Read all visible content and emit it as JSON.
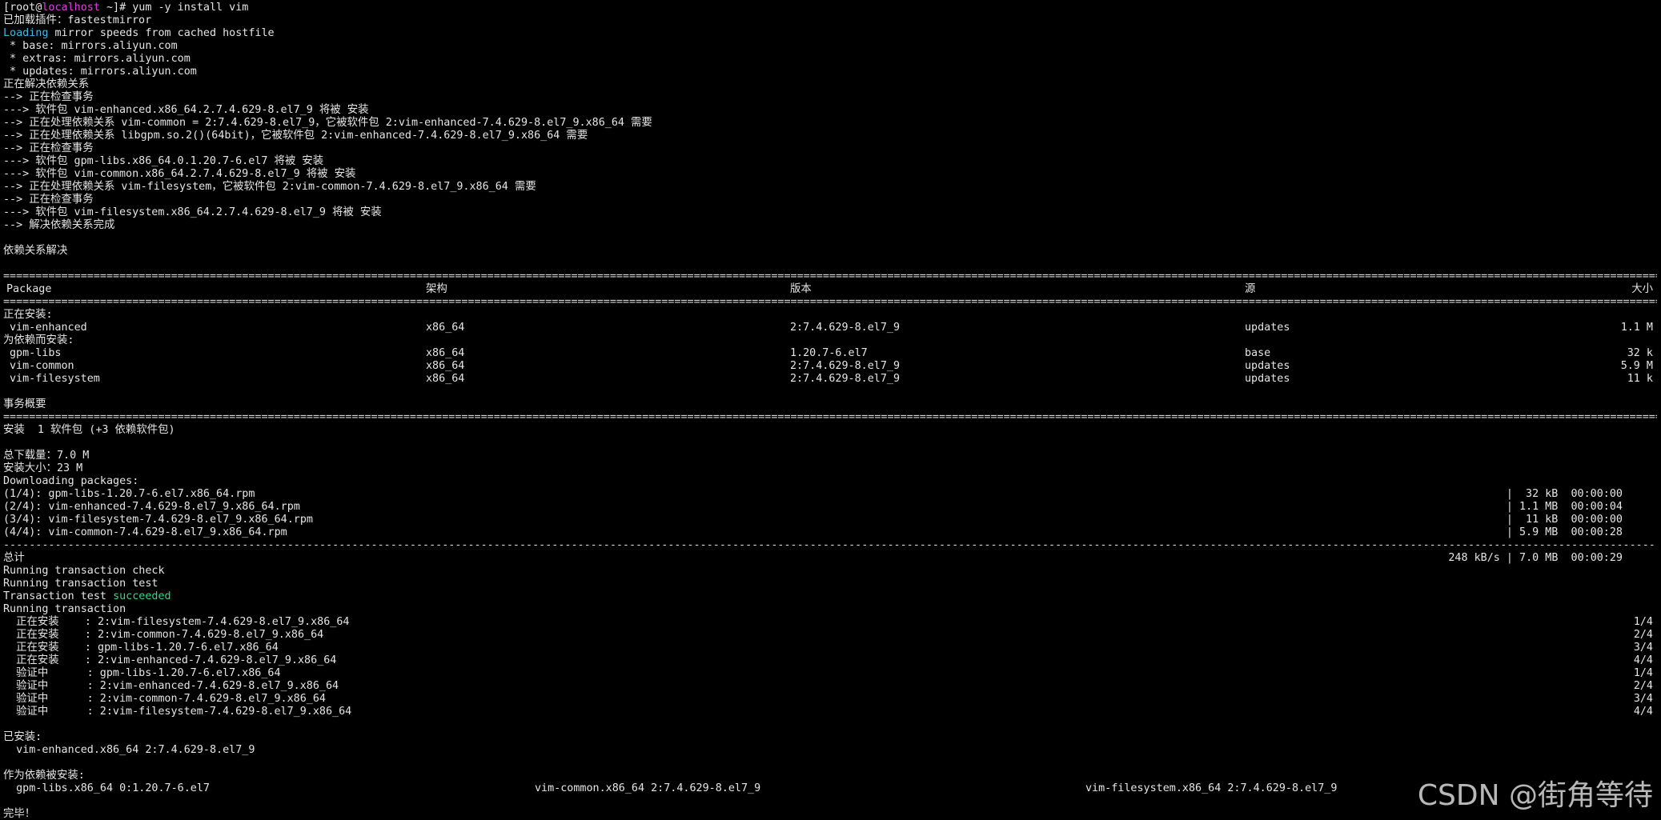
{
  "prompt": {
    "open": "[",
    "user": "root",
    "at": "@",
    "host": "localhost",
    "rest": " ~]# ",
    "command": "yum -y install vim"
  },
  "pre_lines": [
    "已加载插件：fastestmirror"
  ],
  "loading": {
    "word": "Loading",
    "rest": " mirror speeds from cached hostfile"
  },
  "mirror_lines": [
    " * base: mirrors.aliyun.com",
    " * extras: mirrors.aliyun.com",
    " * updates: mirrors.aliyun.com",
    "正在解决依赖关系",
    "--> 正在检查事务",
    "---> 软件包 vim-enhanced.x86_64.2.7.4.629-8.el7_9 将被 安装",
    "--> 正在处理依赖关系 vim-common = 2:7.4.629-8.el7_9，它被软件包 2:vim-enhanced-7.4.629-8.el7_9.x86_64 需要",
    "--> 正在处理依赖关系 libgpm.so.2()(64bit)，它被软件包 2:vim-enhanced-7.4.629-8.el7_9.x86_64 需要",
    "--> 正在检查事务",
    "---> 软件包 gpm-libs.x86_64.0.1.20.7-6.el7 将被 安装",
    "---> 软件包 vim-common.x86_64.2.7.4.629-8.el7_9 将被 安装",
    "--> 正在处理依赖关系 vim-filesystem，它被软件包 2:vim-common-7.4.629-8.el7_9.x86_64 需要",
    "--> 正在检查事务",
    "---> 软件包 vim-filesystem.x86_64.2.7.4.629-8.el7_9 将被 安装",
    "--> 解决依赖关系完成",
    "",
    "依赖关系解决",
    ""
  ],
  "table": {
    "headers": {
      "package": "Package",
      "arch": "架构",
      "version": "版本",
      "repo": "源",
      "size": "大小"
    },
    "installing_label": "正在安装:",
    "installing": [
      {
        "name": "vim-enhanced",
        "arch": "x86_64",
        "version": "2:7.4.629-8.el7_9",
        "repo": "updates",
        "size": "1.1 M"
      }
    ],
    "deps_label": "为依赖而安装:",
    "deps": [
      {
        "name": "gpm-libs",
        "arch": "x86_64",
        "version": "1.20.7-6.el7",
        "repo": "base",
        "size": "32 k"
      },
      {
        "name": "vim-common",
        "arch": "x86_64",
        "version": "2:7.4.629-8.el7_9",
        "repo": "updates",
        "size": "5.9 M"
      },
      {
        "name": "vim-filesystem",
        "arch": "x86_64",
        "version": "2:7.4.629-8.el7_9",
        "repo": "updates",
        "size": "11 k"
      }
    ]
  },
  "summary_title": "事务概要",
  "summary_line": "安装  1 软件包 (+3 依赖软件包)",
  "total_download": "总下载量：7.0 M",
  "install_size": "安装大小：23 M",
  "downloading_label": "Downloading packages:",
  "downloads": [
    {
      "file": "(1/4): gpm-libs-1.20.7-6.el7.x86_64.rpm",
      "stats": "|  32 kB  00:00:00"
    },
    {
      "file": "(2/4): vim-enhanced-7.4.629-8.el7_9.x86_64.rpm",
      "stats": "| 1.1 MB  00:00:04"
    },
    {
      "file": "(3/4): vim-filesystem-7.4.629-8.el7_9.x86_64.rpm",
      "stats": "|  11 kB  00:00:00"
    },
    {
      "file": "(4/4): vim-common-7.4.629-8.el7_9.x86_64.rpm",
      "stats": "| 5.9 MB  00:00:28"
    }
  ],
  "total": {
    "label": "总计",
    "stats": "248 kB/s | 7.0 MB  00:00:29"
  },
  "transaction_lines": [
    "Running transaction check",
    "Running transaction test"
  ],
  "test_result": {
    "prefix": "Transaction test ",
    "status": "succeeded"
  },
  "running_transaction": "Running transaction",
  "steps": [
    {
      "action": "  正在安装    : 2:vim-filesystem-7.4.629-8.el7_9.x86_64",
      "progress": "1/4"
    },
    {
      "action": "  正在安装    : 2:vim-common-7.4.629-8.el7_9.x86_64",
      "progress": "2/4"
    },
    {
      "action": "  正在安装    : gpm-libs-1.20.7-6.el7.x86_64",
      "progress": "3/4"
    },
    {
      "action": "  正在安装    : 2:vim-enhanced-7.4.629-8.el7_9.x86_64",
      "progress": "4/4"
    },
    {
      "action": "  验证中      : gpm-libs-1.20.7-6.el7.x86_64",
      "progress": "1/4"
    },
    {
      "action": "  验证中      : 2:vim-enhanced-7.4.629-8.el7_9.x86_64",
      "progress": "2/4"
    },
    {
      "action": "  验证中      : 2:vim-common-7.4.629-8.el7_9.x86_64",
      "progress": "3/4"
    },
    {
      "action": "  验证中      : 2:vim-filesystem-7.4.629-8.el7_9.x86_64",
      "progress": "4/4"
    }
  ],
  "installed_label": "已安装:",
  "installed": [
    "  vim-enhanced.x86_64 2:7.4.629-8.el7_9"
  ],
  "dep_installed_label": "作为依赖被安装:",
  "dep_installed": [
    "  gpm-libs.x86_64 0:1.20.7-6.el7",
    "vim-common.x86_64 2:7.4.629-8.el7_9",
    "vim-filesystem.x86_64 2:7.4.629-8.el7_9"
  ],
  "complete": "完毕！",
  "watermark": "CSDN @街角等待",
  "colors": {
    "background": "#000000",
    "text": "#e5e5e5",
    "host": "#e040e0",
    "loading": "#3fb8e8",
    "success": "#36d48a"
  }
}
